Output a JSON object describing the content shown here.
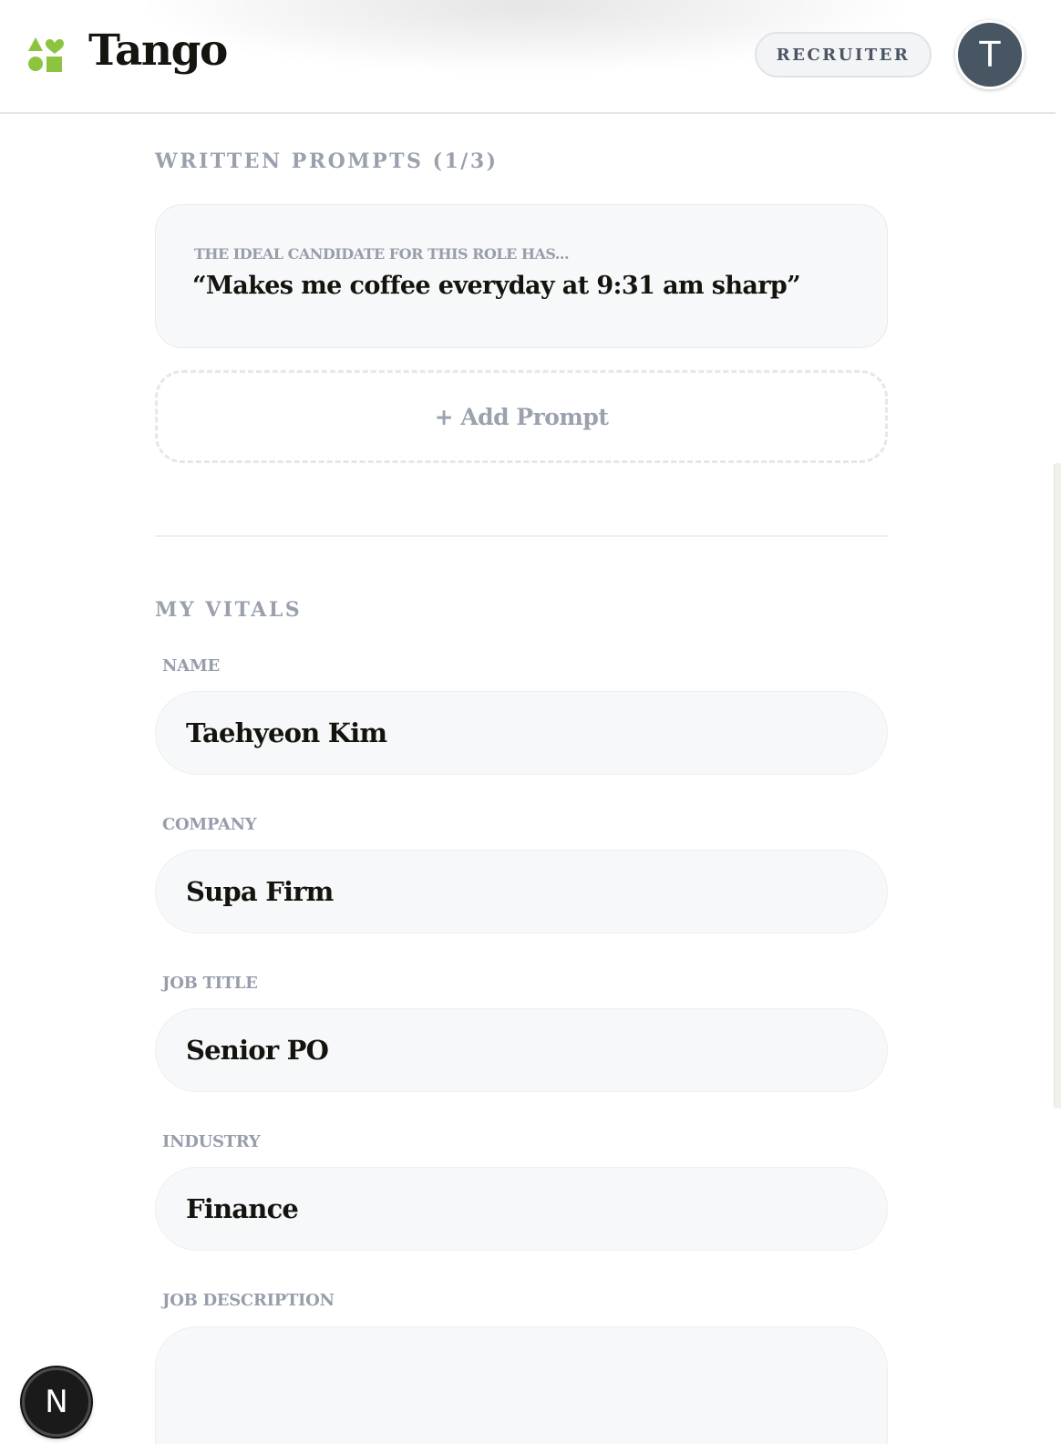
{
  "header": {
    "app_name": "Tango",
    "role_badge": "RECRUITER",
    "avatar_initial": "T",
    "brand_color": "#8cc43f"
  },
  "prompts": {
    "heading": "WRITTEN PROMPTS (1/3)",
    "items": [
      {
        "label": "THE IDEAL CANDIDATE FOR THIS ROLE HAS...",
        "answer": "“Makes me coffee everyday at 9:31 am sharp”"
      }
    ],
    "add_label": "+ Add Prompt"
  },
  "vitals": {
    "heading": "MY VITALS",
    "fields": [
      {
        "label": "NAME",
        "value": "Taehyeon Kim"
      },
      {
        "label": "COMPANY",
        "value": "Supa Firm"
      },
      {
        "label": "JOB TITLE",
        "value": "Senior PO"
      },
      {
        "label": "INDUSTRY",
        "value": "Finance"
      },
      {
        "label": "JOB DESCRIPTION",
        "value": ""
      }
    ]
  },
  "dev_badge": {
    "letter": "N"
  }
}
